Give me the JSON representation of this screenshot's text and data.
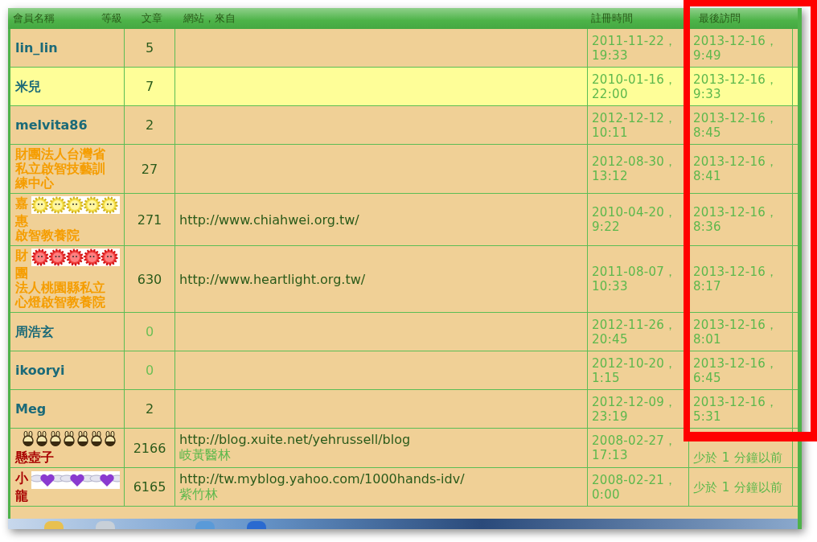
{
  "table": {
    "columns": [
      "會員名稱",
      "等級",
      "文章",
      "網站，來自",
      "註冊時間",
      "最後訪問"
    ],
    "rows": [
      {
        "name_lines": [
          "lin_lin"
        ],
        "color": "#1b6a78",
        "posts": "5",
        "posts_zero": false,
        "highlighted": false,
        "registered": "2011-11-22，19:33",
        "last_visit": "2013-12-16，9:49"
      },
      {
        "name_lines": [
          "米兒"
        ],
        "color": "#1b6a78",
        "posts": "7",
        "posts_zero": false,
        "highlighted": true,
        "registered": "2010-01-16，22:00",
        "last_visit": "2013-12-16，9:33"
      },
      {
        "name_lines": [
          "melvita86"
        ],
        "color": "#1b6a78",
        "posts": "2",
        "posts_zero": false,
        "highlighted": false,
        "registered": "2012-12-12，10:11",
        "last_visit": "2013-12-16，8:45"
      },
      {
        "name_lines": [
          "財團法人台灣省",
          "私立啟智技藝訓",
          "練中心"
        ],
        "color": "#f59d00",
        "posts": "27",
        "posts_zero": false,
        "highlighted": false,
        "registered": "2012-08-30，13:12",
        "last_visit": "2013-12-16，8:41"
      },
      {
        "name_lines": [
          "嘉",
          "惠",
          "啟智教養院"
        ],
        "color": "#f59d00",
        "badge": {
          "kind": "sun",
          "beside": true
        },
        "posts": "271",
        "posts_zero": false,
        "highlighted": false,
        "website": "http://www.chiahwei.org.tw/",
        "registered": "2010-04-20，9:22",
        "last_visit": "2013-12-16，8:36"
      },
      {
        "name_lines": [
          "財",
          "團",
          "法人桃園縣私立",
          "心燈啟智教養院"
        ],
        "color": "#f59d00",
        "badge": {
          "kind": "red-sun",
          "beside": true
        },
        "posts": "630",
        "posts_zero": false,
        "highlighted": false,
        "website": "http://www.heartlight.org.tw/",
        "registered": "2011-08-07，10:33",
        "last_visit": "2013-12-16，8:17"
      },
      {
        "name_lines": [
          "周浩玄"
        ],
        "color": "#1b6a78",
        "posts": "0",
        "posts_zero": true,
        "highlighted": false,
        "registered": "2012-11-26，20:45",
        "last_visit": "2013-12-16，8:01"
      },
      {
        "name_lines": [
          "ikooryi"
        ],
        "color": "#1b6a78",
        "posts": "0",
        "posts_zero": true,
        "highlighted": false,
        "registered": "2012-10-20，1:15",
        "last_visit": "2013-12-16，6:45"
      },
      {
        "name_lines": [
          "Meg"
        ],
        "color": "#1b6a78",
        "posts": "2",
        "posts_zero": false,
        "highlighted": false,
        "registered": "2012-12-09，23:19",
        "last_visit": "2013-12-16，5:31"
      },
      {
        "name_lines": [
          "懸壺子"
        ],
        "color": "#a80000",
        "badge": {
          "kind": "bunny",
          "beside": false
        },
        "posts": "2166",
        "posts_zero": false,
        "highlighted": false,
        "website": "http://blog.xuite.net/yehrussell/blog",
        "from": "岐黃醫林",
        "registered": "2008-02-27，17:13",
        "last_visit": "少於 1 分鐘以前"
      },
      {
        "name_lines": [
          "小",
          "龍"
        ],
        "color": "#a80000",
        "badge": {
          "kind": "heart",
          "beside": true
        },
        "posts": "6165",
        "posts_zero": false,
        "highlighted": false,
        "website": "http://tw.myblog.yahoo.com/1000hands-idv/",
        "from": "紫竹林",
        "registered": "2008-02-21，0:00",
        "last_visit": "少於 1 分鐘以前"
      }
    ]
  }
}
